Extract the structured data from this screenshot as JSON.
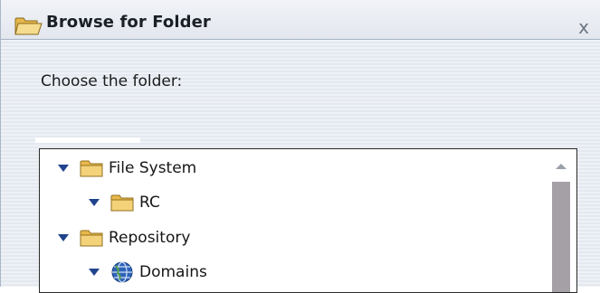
{
  "dialog": {
    "title": "Browse for Folder",
    "close_label": "x",
    "prompt": "Choose the folder:",
    "title_icon": "folder-open-icon"
  },
  "tree": {
    "items": [
      {
        "label": "File System",
        "icon": "folder-icon",
        "expanded": true
      },
      {
        "label": "RC",
        "icon": "folder-icon",
        "expanded": true
      },
      {
        "label": "Repository",
        "icon": "folder-icon",
        "expanded": true
      },
      {
        "label": "Domains",
        "icon": "globe-icon",
        "expanded": true
      }
    ]
  },
  "colors": {
    "expander": "#20448c",
    "folder": "#e8b84a",
    "scroll_thumb": "#a59fa6"
  }
}
